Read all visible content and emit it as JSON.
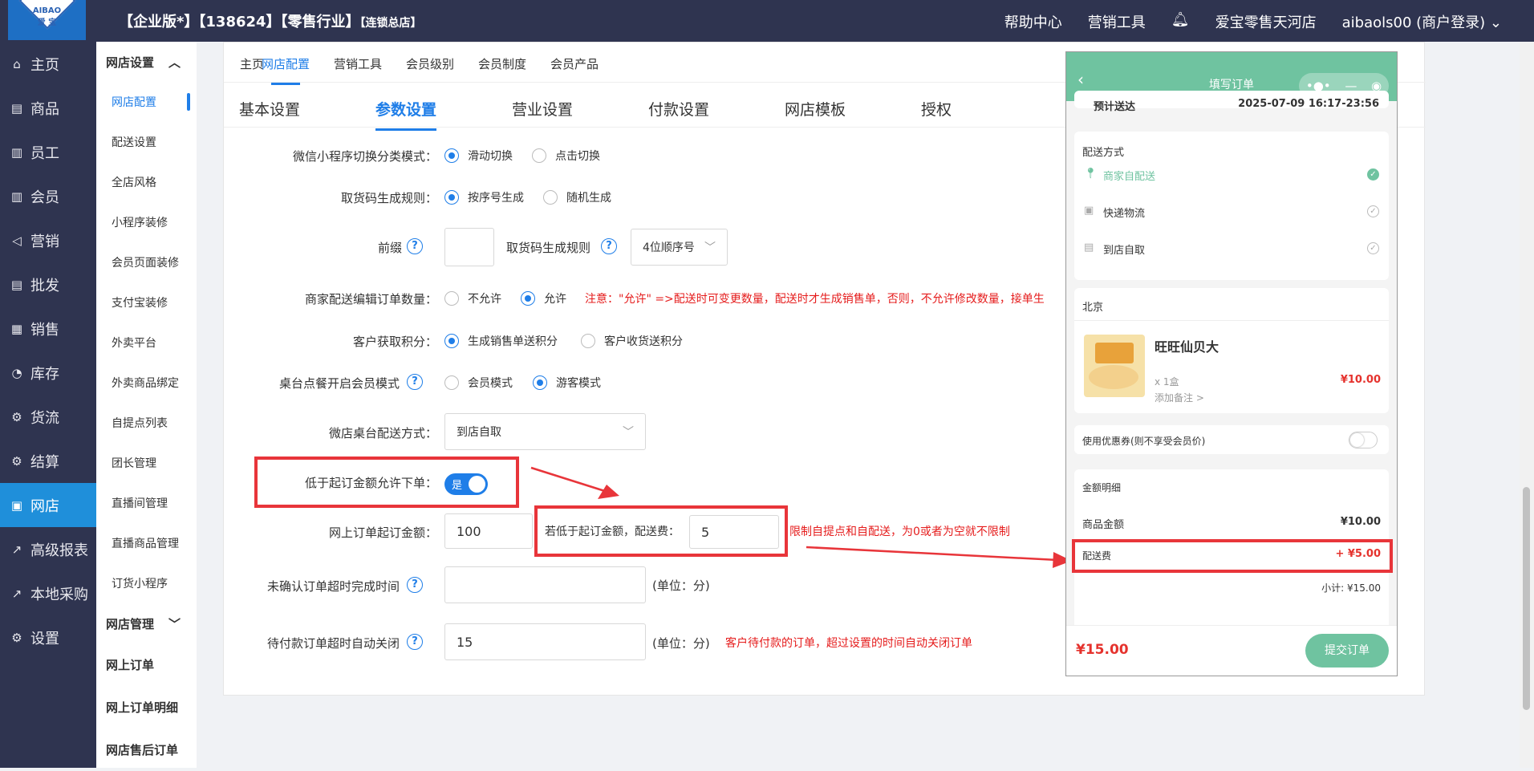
{
  "topbar": {
    "logo_text": "AIBAO",
    "logo_sub": "爱 宝",
    "title": "【企业版*】【138624】【零售行业】",
    "title_small": "【连锁总店】",
    "help": "帮助中心",
    "marketing": "营销工具",
    "store": "爱宝零售天河店",
    "user": "aibaols00 (商户登录)"
  },
  "sidebar": {
    "items": [
      {
        "label": "主页",
        "icon": "⌂"
      },
      {
        "label": "商品",
        "icon": "▤"
      },
      {
        "label": "员工",
        "icon": "▥"
      },
      {
        "label": "会员",
        "icon": "▥"
      },
      {
        "label": "营销",
        "icon": "◁"
      },
      {
        "label": "批发",
        "icon": "▤"
      },
      {
        "label": "销售",
        "icon": "▦"
      },
      {
        "label": "库存",
        "icon": "◔"
      },
      {
        "label": "货流",
        "icon": "⚙"
      },
      {
        "label": "结算",
        "icon": "⚙"
      },
      {
        "label": "网店",
        "icon": "▣"
      },
      {
        "label": "高级报表",
        "icon": "↗"
      },
      {
        "label": "本地采购",
        "icon": "↗"
      },
      {
        "label": "设置",
        "icon": "⚙"
      }
    ]
  },
  "subnav": {
    "group1": "网店设置",
    "items": [
      "网店配置",
      "配送设置",
      "全店风格",
      "小程序装修",
      "会员页面装修",
      "支付宝装修",
      "外卖平台",
      "外卖商品绑定",
      "自提点列表",
      "团长管理",
      "直播间管理",
      "直播商品管理",
      "订货小程序"
    ],
    "group2": "网店管理",
    "links": [
      "网上订单",
      "网上订单明细",
      "网店售后订单"
    ]
  },
  "tabs1": [
    "主页",
    "网店配置",
    "营销工具",
    "会员级别",
    "会员制度",
    "会员产品"
  ],
  "tabs2": [
    "基本设置",
    "参数设置",
    "营业设置",
    "付款设置",
    "网店模板",
    "授权"
  ],
  "form": {
    "switch_mode": {
      "label": "微信小程序切换分类模式：",
      "opt1": "滑动切换",
      "opt2": "点击切换"
    },
    "pickup_rule": {
      "label": "取货码生成规则：",
      "opt1": "按序号生成",
      "opt2": "随机生成"
    },
    "prefix": {
      "label": "前缀",
      "rule_label": "取货码生成规则",
      "rule_value": "4位顺序号"
    },
    "edit_qty": {
      "label": "商家配送编辑订单数量：",
      "opt1": "不允许",
      "opt2": "允许",
      "note": "注意：\"允许\" =>配送时可变更数量，配送时才生成销售单，否则，不允许修改数量，接单生"
    },
    "points": {
      "label": "客户获取积分：",
      "opt1": "生成销售单送积分",
      "opt2": "客户收货送积分"
    },
    "table_member": {
      "label": "桌台点餐开启会员模式",
      "opt1": "会员模式",
      "opt2": "游客模式"
    },
    "table_delivery": {
      "label": "微店桌台配送方式：",
      "value": "到店自取"
    },
    "below_min": {
      "label": "低于起订金额允许下单：",
      "toggle": "是"
    },
    "min_amount": {
      "label": "网上订单起订金额：",
      "value": "100",
      "fee_label": "若低于起订金额，配送费：",
      "fee_value": "5",
      "note": "限制自提点和自配送，为0或者为空就不限制"
    },
    "unconfirmed": {
      "label": "未确认订单超时完成时间",
      "value": "",
      "unit": "(单位：分)"
    },
    "unpaid": {
      "label": "待付款订单超时自动关闭",
      "value": "15",
      "unit": "(单位：分)",
      "note": "客户待付款的订单，超过设置的时间自动关闭订单"
    }
  },
  "phone": {
    "title": "填写订单",
    "eta_label": "预计送达",
    "eta_value": "2025-07-09 16:17-23:56",
    "delivery_title": "配送方式",
    "delivery_opts": [
      "商家自配送",
      "快递物流",
      "到店自取"
    ],
    "store": "北京",
    "product_name": "旺旺仙贝大",
    "product_qty": "x 1盒",
    "product_price": "¥10.00",
    "product_note": "添加备注 >",
    "coupon": "使用优惠券(则不享受会员价)",
    "amount_title": "金额明细",
    "goods_label": "商品金额",
    "goods_value": "¥10.00",
    "fee_label": "配送费",
    "fee_value": "+ ¥5.00",
    "subtotal": "小计: ¥15.00",
    "total": "¥15.00",
    "submit": "提交订单"
  },
  "colors": {
    "accent": "#1f7ee8",
    "sidebar": "#2f3450",
    "phone_green": "#6fc3a0",
    "annotation_red": "#e8353a"
  }
}
